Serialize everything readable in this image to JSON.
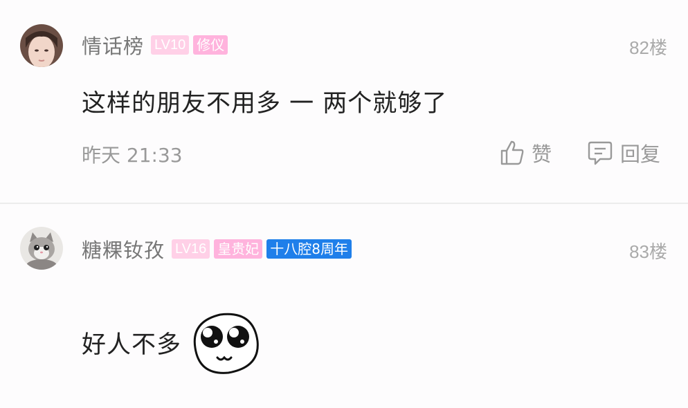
{
  "posts": [
    {
      "username": "情话榜",
      "level_badge": "LV10",
      "title_badge": "修仪",
      "floor": "82楼",
      "content": "这样的朋友不用多 一 两个就够了",
      "timestamp": "昨天 21:33",
      "like_label": "赞",
      "reply_label": "回复",
      "avatar_icon": "woman-portrait-avatar"
    },
    {
      "username": "糖粿钕孜",
      "level_badge": "LV16",
      "title_badge": "皇贵妃",
      "anniv_badge": "十八腔8周年",
      "floor": "83楼",
      "content": "好人不多",
      "emoji_icon": "cute-face-emoji",
      "avatar_icon": "kitten-avatar"
    }
  ],
  "colors": {
    "level_badge_bg": "#ffd0e7",
    "title_badge_bg": "#ffb3dd",
    "anniv_badge_bg": "#1f7fea",
    "muted_text": "#999999"
  }
}
